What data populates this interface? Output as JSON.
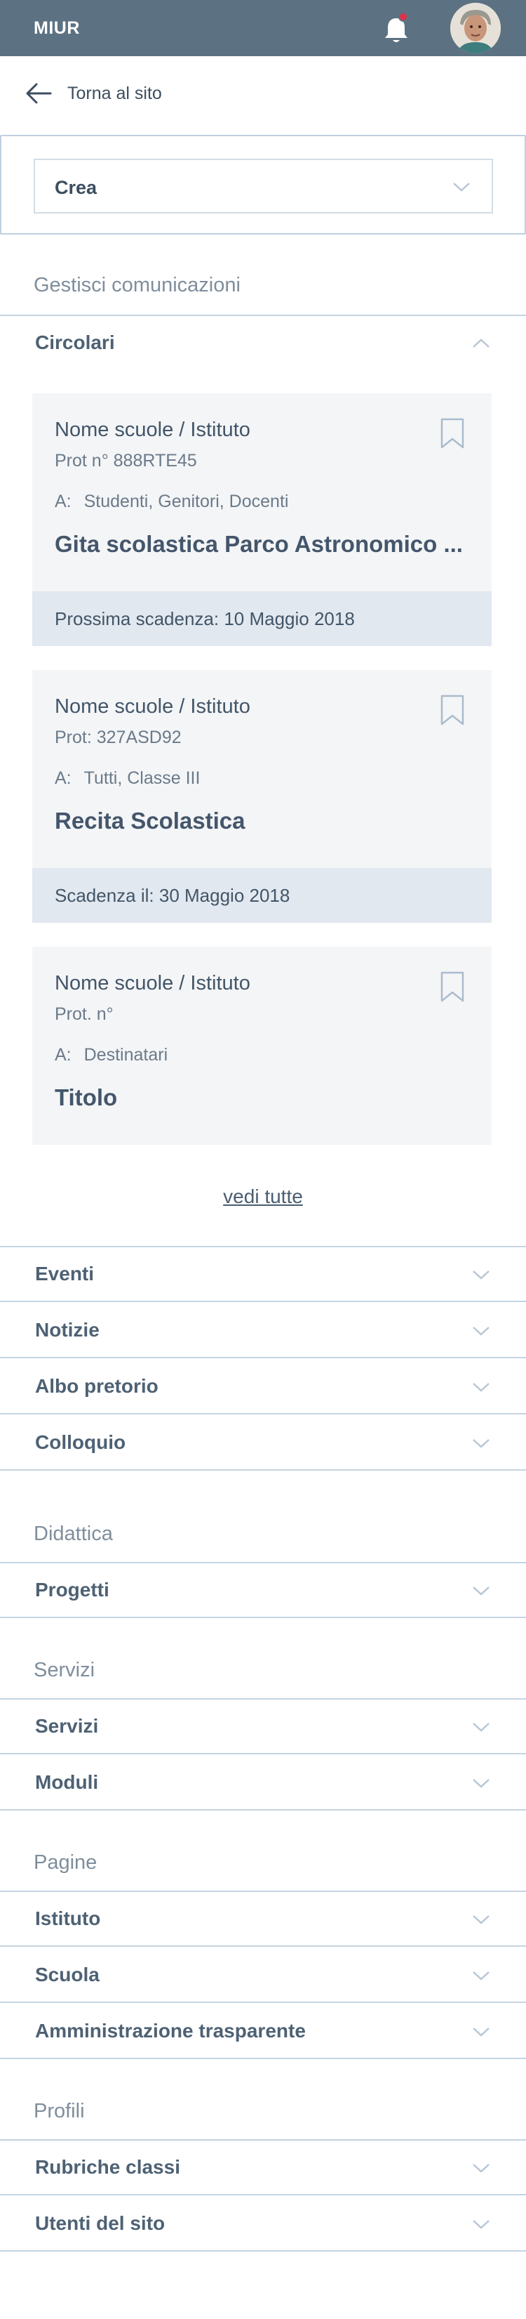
{
  "header": {
    "brand": "MIUR",
    "notification_dot_color": "#e0304a"
  },
  "nav": {
    "back_label": "Torna al sito"
  },
  "create": {
    "selected": "Crea"
  },
  "sections": {
    "gestisci": "Gestisci comunicazioni",
    "didattica": "Didattica",
    "servizi": "Servizi",
    "pagine": "Pagine",
    "profili": "Profili"
  },
  "circolari": {
    "label": "Circolari",
    "cards": [
      {
        "school": "Nome scuole / Istituto",
        "prot": "Prot n° 888RTE45",
        "to_prefix": "A:",
        "to": "Studenti, Genitori, Docenti",
        "title": "Gita scolastica Parco Astronomico ...",
        "deadline": "Prossima scadenza: 10 Maggio 2018"
      },
      {
        "school": "Nome scuole / Istituto",
        "prot": "Prot: 327ASD92",
        "to_prefix": "A:",
        "to": "Tutti, Classe III",
        "title": "Recita Scolastica",
        "deadline": "Scadenza il: 30 Maggio 2018"
      },
      {
        "school": "Nome scuole / Istituto",
        "prot": "Prot. n°",
        "to_prefix": "A:",
        "to": "Destinatari",
        "title": "Titolo"
      }
    ],
    "see_all": "vedi tutte"
  },
  "menu": {
    "eventi": "Eventi",
    "notizie": "Notizie",
    "albo": "Albo pretorio",
    "colloquio": "Colloquio",
    "progetti": "Progetti",
    "servizi": "Servizi",
    "moduli": "Moduli",
    "istituto": "Istituto",
    "scuola": "Scuola",
    "amministrazione": "Amministrazione trasparente",
    "rubriche": "Rubriche classi",
    "utenti": "Utenti del sito"
  }
}
